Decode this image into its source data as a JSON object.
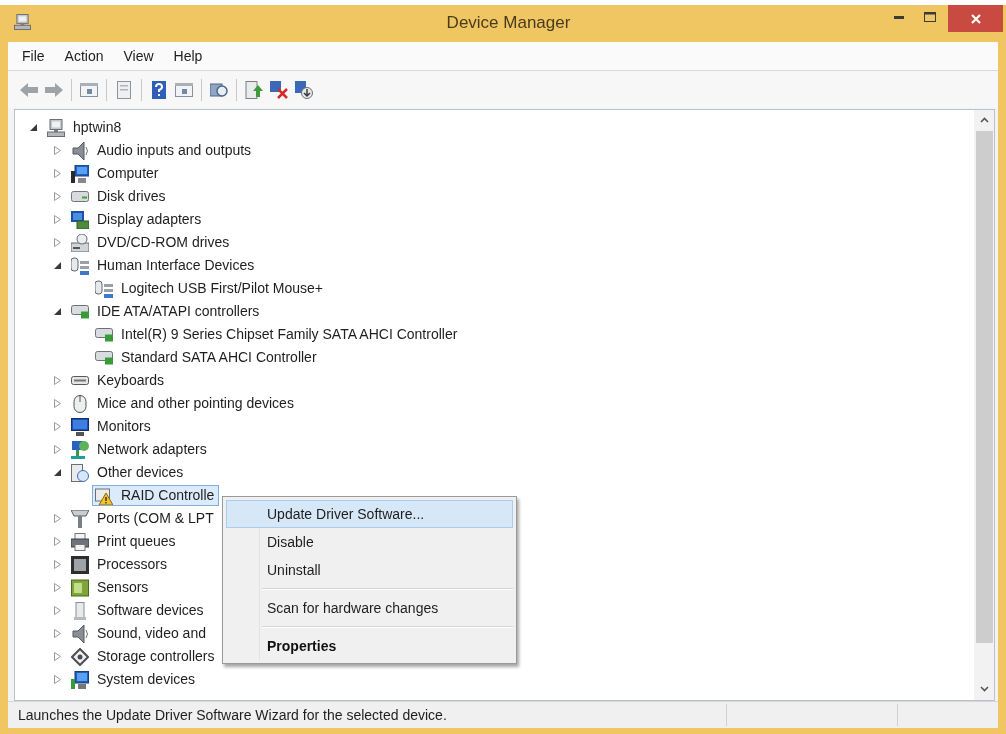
{
  "window": {
    "title": "Device Manager"
  },
  "menu_bar": [
    "File",
    "Action",
    "View",
    "Help"
  ],
  "tree": [
    {
      "label": "hptwin8",
      "kind": "host",
      "expanded": true,
      "selected": false,
      "children": [
        {
          "label": "Audio inputs and outputs",
          "kind": "audio",
          "expanded": false,
          "selected": false
        },
        {
          "label": "Computer",
          "kind": "computer",
          "expanded": false,
          "selected": false
        },
        {
          "label": "Disk drives",
          "kind": "disk",
          "expanded": false,
          "selected": false
        },
        {
          "label": "Display adapters",
          "kind": "display",
          "expanded": false,
          "selected": false
        },
        {
          "label": "DVD/CD-ROM drives",
          "kind": "dvd",
          "expanded": false,
          "selected": false
        },
        {
          "label": "Human Interface Devices",
          "kind": "hid",
          "expanded": true,
          "selected": false,
          "children": [
            {
              "label": "Logitech USB First/Pilot Mouse+",
              "kind": "hid",
              "selected": false
            }
          ]
        },
        {
          "label": "IDE ATA/ATAPI controllers",
          "kind": "ide",
          "expanded": true,
          "selected": false,
          "children": [
            {
              "label": "Intel(R) 9 Series Chipset Family SATA AHCI Controller",
              "kind": "ide",
              "selected": false
            },
            {
              "label": "Standard SATA AHCI Controller",
              "kind": "ide",
              "selected": false
            }
          ]
        },
        {
          "label": "Keyboards",
          "kind": "keyboard",
          "expanded": false,
          "selected": false
        },
        {
          "label": "Mice and other pointing devices",
          "kind": "mouse",
          "expanded": false,
          "selected": false
        },
        {
          "label": "Monitors",
          "kind": "monitor",
          "expanded": false,
          "selected": false
        },
        {
          "label": "Network adapters",
          "kind": "network",
          "expanded": false,
          "selected": false
        },
        {
          "label": "Other devices",
          "kind": "other",
          "expanded": true,
          "selected": false,
          "children": [
            {
              "label": "RAID Controlle",
              "kind": "warning",
              "selected": true
            }
          ]
        },
        {
          "label": "Ports (COM & LPT",
          "kind": "port",
          "expanded": false,
          "selected": false
        },
        {
          "label": "Print queues",
          "kind": "printer",
          "expanded": false,
          "selected": false
        },
        {
          "label": "Processors",
          "kind": "processor",
          "expanded": false,
          "selected": false
        },
        {
          "label": "Sensors",
          "kind": "sensor",
          "expanded": false,
          "selected": false
        },
        {
          "label": "Software devices",
          "kind": "software",
          "expanded": false,
          "selected": false
        },
        {
          "label": "Sound, video and",
          "kind": "audio",
          "expanded": false,
          "selected": false
        },
        {
          "label": "Storage controllers",
          "kind": "storage",
          "expanded": false,
          "selected": false
        },
        {
          "label": "System devices",
          "kind": "system",
          "expanded": false,
          "selected": false
        }
      ]
    }
  ],
  "context_menu": {
    "items": [
      {
        "kind": "item",
        "label": "Update Driver Software...",
        "selected": true,
        "default": false
      },
      {
        "kind": "item",
        "label": "Disable",
        "selected": false,
        "default": false
      },
      {
        "kind": "item",
        "label": "Uninstall",
        "selected": false,
        "default": false
      },
      {
        "kind": "separator"
      },
      {
        "kind": "item",
        "label": "Scan for hardware changes",
        "selected": false,
        "default": false
      },
      {
        "kind": "separator"
      },
      {
        "kind": "item",
        "label": "Properties",
        "selected": false,
        "default": true
      }
    ]
  },
  "status_bar": {
    "text": "Launches the Update Driver Software Wizard for the selected device."
  }
}
